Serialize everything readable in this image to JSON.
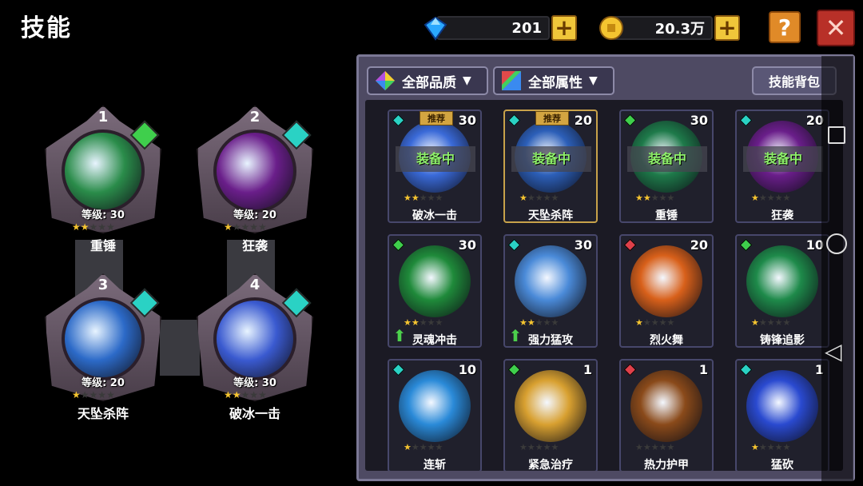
{
  "header": {
    "title": "技能"
  },
  "currency": {
    "gems": "201",
    "gold": "20.3万",
    "plus": "+"
  },
  "buttons": {
    "help": "?",
    "close": "✕"
  },
  "icons": {
    "gem": "diamond-icon",
    "gold": "gold-coin-icon",
    "help": "question-mark-icon",
    "close": "close-icon",
    "quality": "rainbow-gem-icon",
    "attribute": "color-swatch-icon"
  },
  "slots": [
    {
      "num": "1",
      "level": "等级: 30",
      "name": "重锤",
      "stars": 2,
      "gem_color": "#3fcf4c",
      "gem_symbol": "✚",
      "orb": "#2a8c4a"
    },
    {
      "num": "2",
      "level": "等级: 20",
      "name": "狂袭",
      "stars": 1,
      "gem_color": "#2ad2c4",
      "gem_symbol": "",
      "orb": "#6a1e8a"
    },
    {
      "num": "3",
      "level": "等级: 20",
      "name": "天坠杀阵",
      "stars": 1,
      "gem_color": "#2ad2c4",
      "gem_symbol": "",
      "orb": "#2c6ac8"
    },
    {
      "num": "4",
      "level": "等级: 30",
      "name": "破冰一击",
      "stars": 2,
      "gem_color": "#2ad2c4",
      "gem_symbol": "",
      "orb": "#3a5ad0"
    }
  ],
  "filters": {
    "quality": "全部品质",
    "attribute": "全部属性",
    "bag": "技能背包"
  },
  "tags": {
    "equipped": "装备中",
    "recommended": "推荐"
  },
  "inventory": [
    {
      "name": "破冰一击",
      "count": "30",
      "stars": 2,
      "equipped": true,
      "recommended": true,
      "upgrade": false,
      "selected": false,
      "gem": "#2ad2c4",
      "art": "#3a6ad8"
    },
    {
      "name": "天坠杀阵",
      "count": "20",
      "stars": 1,
      "equipped": true,
      "recommended": true,
      "upgrade": false,
      "selected": true,
      "gem": "#2ad2c4",
      "art": "#2c5fb8"
    },
    {
      "name": "重锤",
      "count": "30",
      "stars": 2,
      "equipped": true,
      "recommended": false,
      "upgrade": false,
      "selected": false,
      "gem": "#3fcf4c",
      "art": "#1e7a4a"
    },
    {
      "name": "狂袭",
      "count": "20",
      "stars": 1,
      "equipped": true,
      "recommended": false,
      "upgrade": false,
      "selected": false,
      "gem": "#2ad2c4",
      "art": "#6a1e8a"
    },
    {
      "name": "灵魂冲击",
      "count": "30",
      "stars": 2,
      "equipped": false,
      "recommended": false,
      "upgrade": true,
      "selected": false,
      "gem": "#3fcf4c",
      "art": "#1f8a3a"
    },
    {
      "name": "强力猛攻",
      "count": "30",
      "stars": 2,
      "equipped": false,
      "recommended": false,
      "upgrade": true,
      "selected": false,
      "gem": "#2ad2c4",
      "art": "#4a8ad8"
    },
    {
      "name": "烈火舞",
      "count": "20",
      "stars": 1,
      "equipped": false,
      "recommended": false,
      "upgrade": false,
      "selected": false,
      "gem": "#e0404a",
      "art": "#d8601a"
    },
    {
      "name": "铸锋追影",
      "count": "10",
      "stars": 1,
      "equipped": false,
      "recommended": false,
      "upgrade": false,
      "selected": false,
      "gem": "#3fcf4c",
      "art": "#1e8a4a"
    },
    {
      "name": "连斩",
      "count": "10",
      "stars": 1,
      "equipped": false,
      "recommended": false,
      "upgrade": false,
      "selected": false,
      "gem": "#2ad2c4",
      "art": "#2a8ad8"
    },
    {
      "name": "紧急治疗",
      "count": "1",
      "stars": 0,
      "equipped": false,
      "recommended": false,
      "upgrade": false,
      "selected": false,
      "gem": "#3fcf4c",
      "art": "#d8a030"
    },
    {
      "name": "热力护甲",
      "count": "1",
      "stars": 0,
      "equipped": false,
      "recommended": false,
      "upgrade": false,
      "selected": false,
      "gem": "#e0404a",
      "art": "#8a4a1a"
    },
    {
      "name": "猛砍",
      "count": "1",
      "stars": 1,
      "equipped": false,
      "recommended": false,
      "upgrade": false,
      "selected": false,
      "gem": "#2ad2c4",
      "art": "#2a4ad0"
    }
  ],
  "colors": {
    "panel": "#4e4a63",
    "accent_gold": "#f0c63a",
    "close_red": "#b83028",
    "help_orange": "#e08a28"
  }
}
